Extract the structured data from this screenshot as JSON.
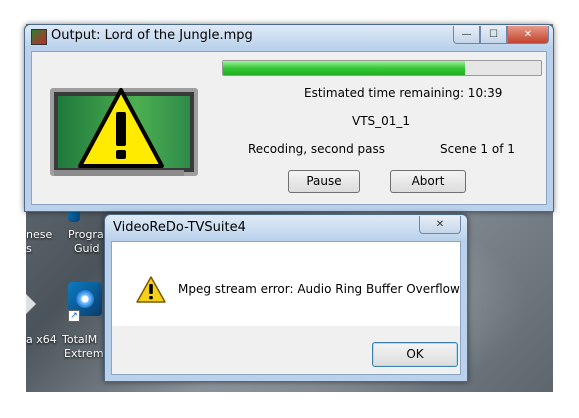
{
  "desktop": {
    "labels": [
      {
        "text": "nese"
      },
      {
        "text": "s"
      },
      {
        "text": "Progra"
      },
      {
        "text": "Guid"
      },
      {
        "text": "a x64"
      },
      {
        "text": "TotalM"
      },
      {
        "text": "Extrem"
      }
    ]
  },
  "output_window": {
    "title": "Output: Lord of the Jungle.mpg",
    "progress_fraction": 0.76,
    "estimated_time": "Estimated time remaining: 10:39",
    "title_id": "VTS_01_1",
    "status": "Recoding, second pass",
    "scene": "Scene 1 of 1",
    "pause_label": "Pause",
    "abort_label": "Abort",
    "min_glyph": "—",
    "max_glyph": "☐",
    "close_glyph": "✕"
  },
  "error_dialog": {
    "title": "VideoReDo-TVSuite4",
    "message": "Mpeg stream error: Audio Ring Buffer Overflow",
    "ok_label": "OK",
    "close_glyph": "✕"
  },
  "colors": {
    "progress": "#37c837",
    "warning_yellow": "#ffeb00"
  }
}
